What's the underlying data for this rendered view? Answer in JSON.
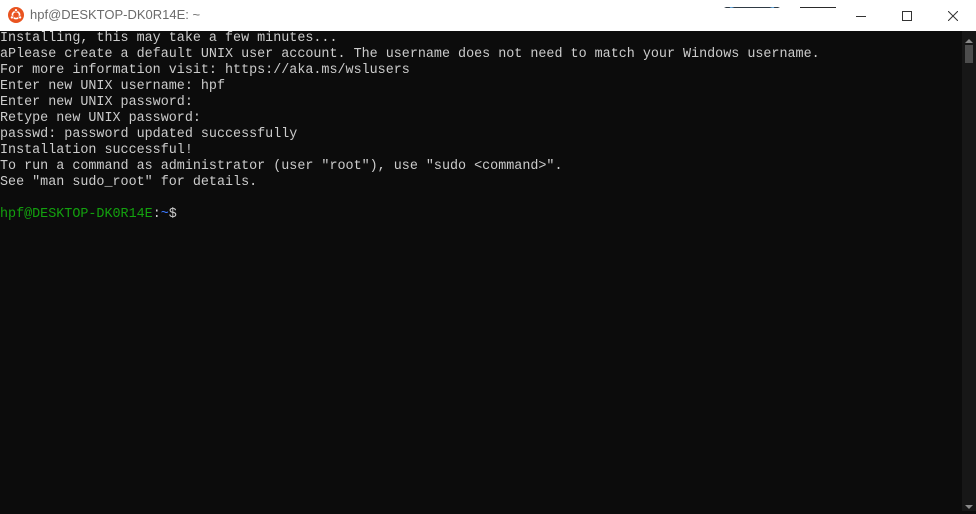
{
  "window": {
    "title": "hpf@DESKTOP-DK0R14E: ~"
  },
  "colors": {
    "titlebar_bg": "#ffffff",
    "terminal_bg": "#0c0c0c",
    "text": "#cccccc",
    "prompt_user": "#13a10e",
    "prompt_path": "#3b78ff",
    "ubuntu_orange": "#e95420"
  },
  "icons": {
    "app": "ubuntu-logo-icon",
    "minimize": "minimize-icon",
    "maximize": "maximize-icon",
    "close": "close-icon"
  },
  "terminal": {
    "lines": [
      "Installing, this may take a few minutes...",
      "aPlease create a default UNIX user account. The username does not need to match your Windows username.",
      "For more information visit: https://aka.ms/wslusers",
      "Enter new UNIX username: hpf",
      "Enter new UNIX password:",
      "Retype new UNIX password:",
      "passwd: password updated successfully",
      "Installation successful!",
      "To run a command as administrator (user \"root\"), use \"sudo <command>\".",
      "See \"man sudo_root\" for details."
    ],
    "prompt": {
      "user_host": "hpf@DESKTOP-DK0R14E",
      "colon": ":",
      "path": "~",
      "symbol": "$"
    }
  }
}
